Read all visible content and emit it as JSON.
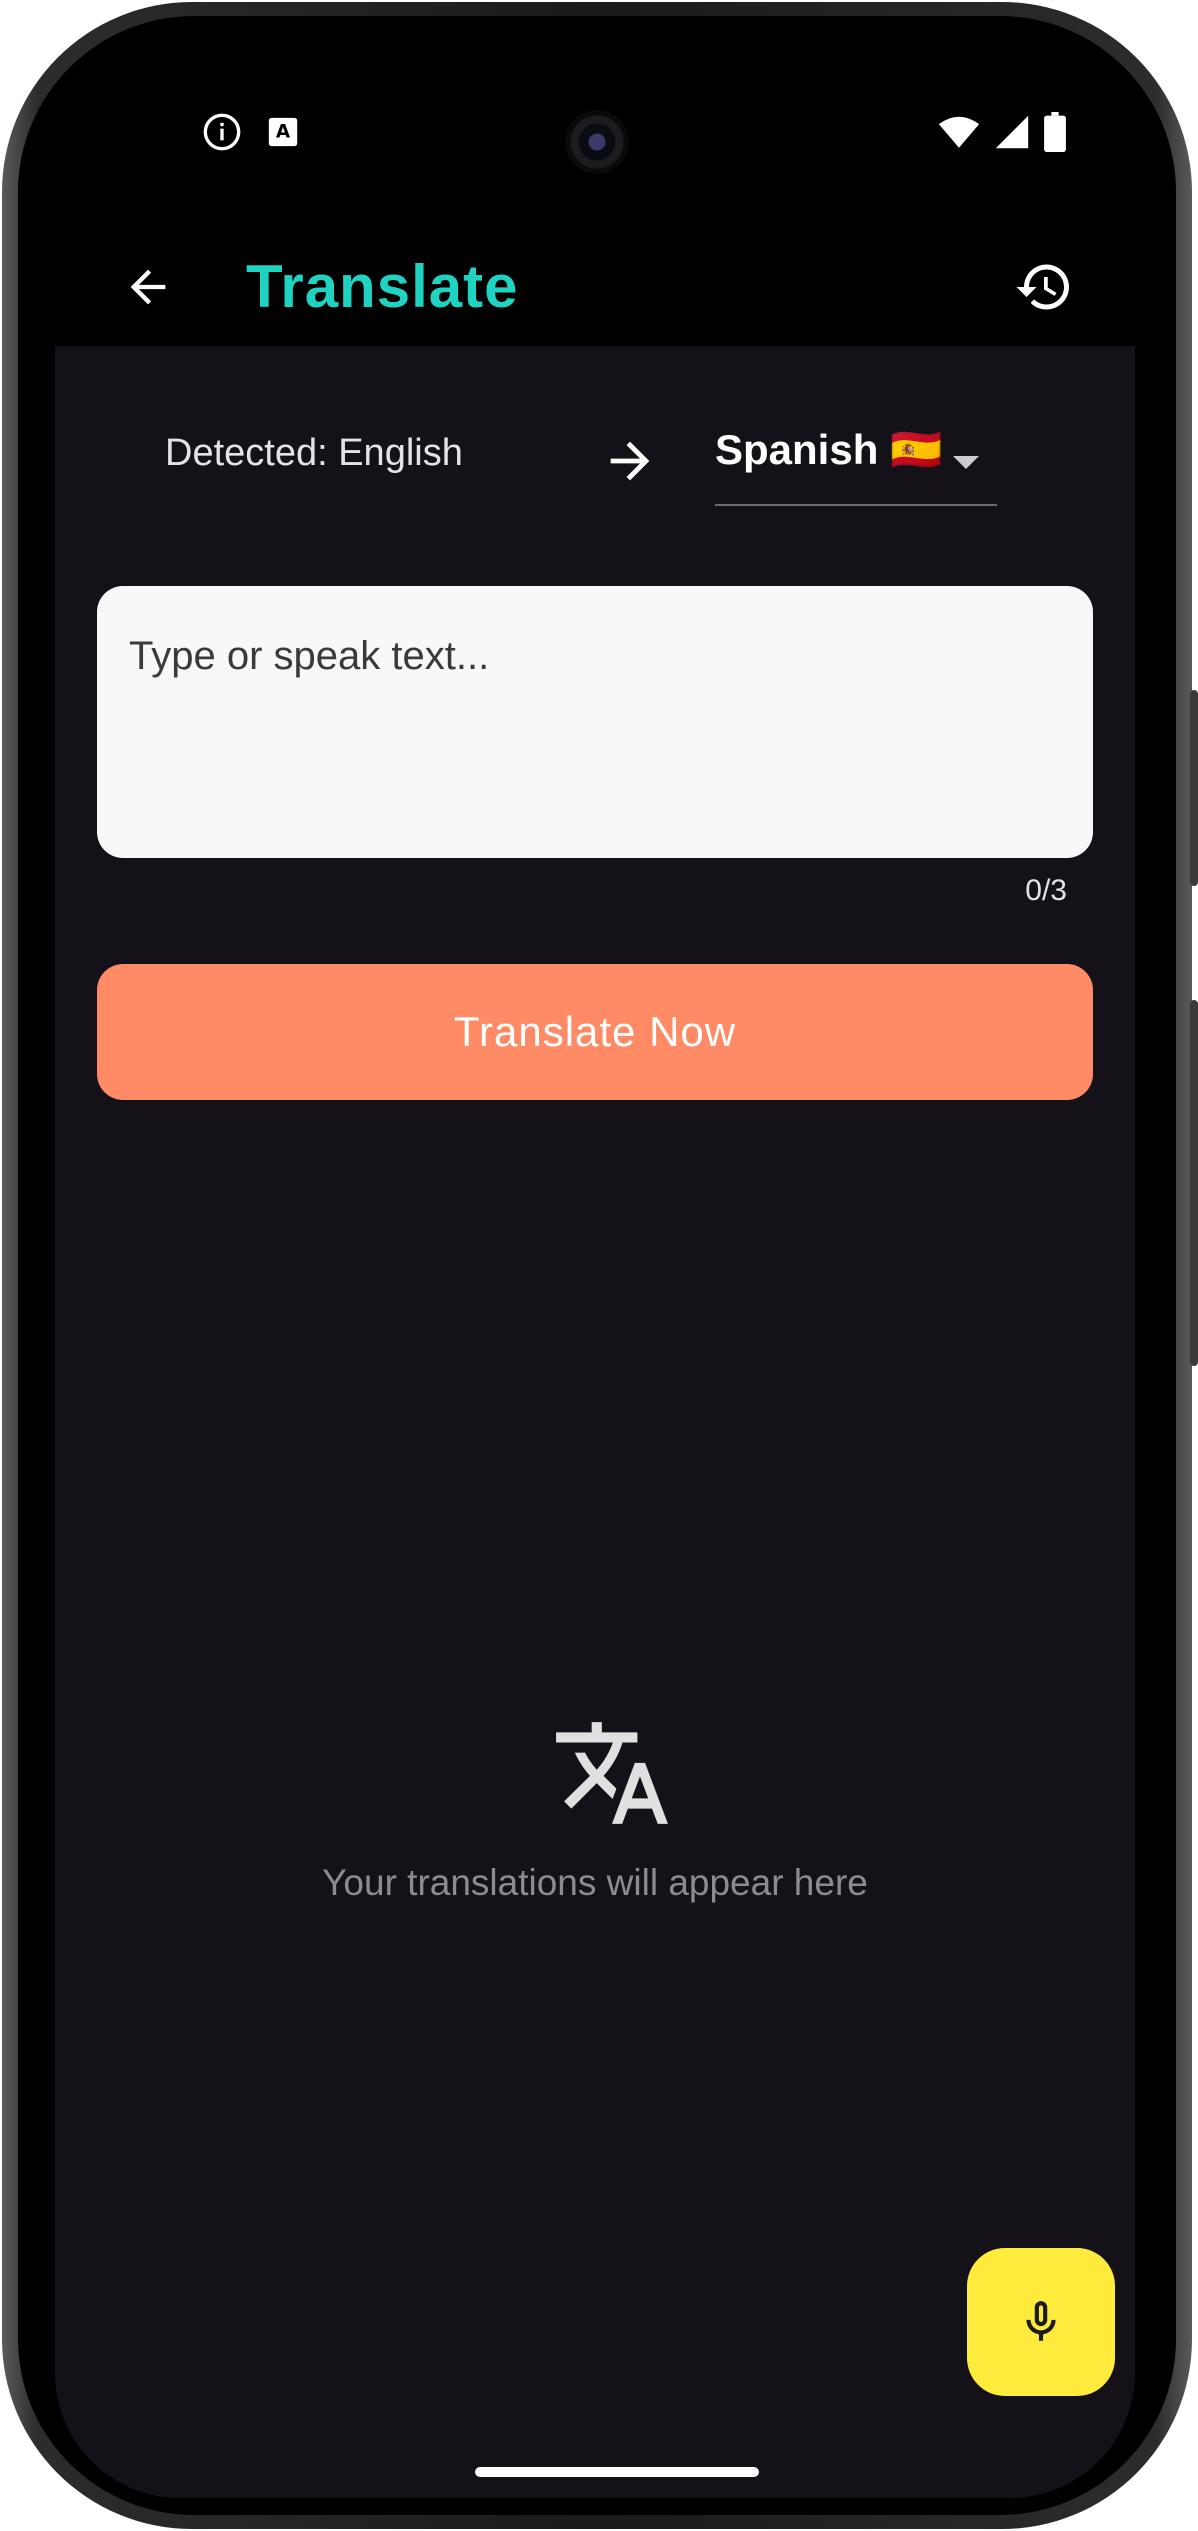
{
  "app_bar": {
    "title": "Translate",
    "back_icon": "arrow-back-icon",
    "history_icon": "history-icon"
  },
  "status_bar": {
    "left_icons": [
      "info-icon",
      "text-recognition-icon"
    ],
    "right_icons": [
      "wifi-icon",
      "cellular-signal-icon",
      "battery-icon"
    ]
  },
  "language_row": {
    "detected_label": "Detected: English",
    "arrow_icon": "arrow-forward-icon",
    "target_language": "Spanish 🇪🇸",
    "dropdown_icon": "dropdown-caret-icon"
  },
  "input": {
    "placeholder": "Type or speak text...",
    "value": "",
    "counter": "0/3"
  },
  "translate_button": {
    "label": "Translate Now"
  },
  "empty_state": {
    "icon": "translate-icon",
    "message": "Your translations will appear here"
  },
  "fab": {
    "icon": "microphone-icon"
  },
  "colors": {
    "accent_title": "#1ed3c2",
    "button": "#ff8a66",
    "fab": "#ffeb3b",
    "background": "#141218"
  }
}
